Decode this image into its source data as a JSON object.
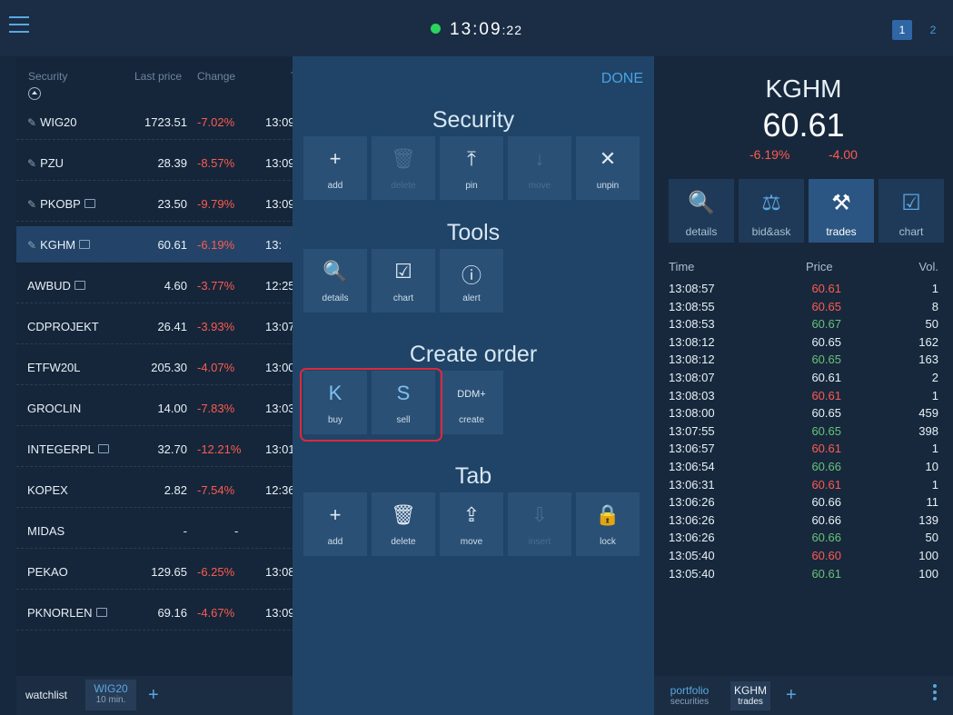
{
  "header": {
    "clock_main": "13:09",
    "clock_seconds": ":22",
    "pages": [
      "1",
      "2"
    ]
  },
  "watchlist": {
    "columns": {
      "security": "Security",
      "last_price": "Last price",
      "change": "Change",
      "time": "T"
    },
    "rows": [
      {
        "name": "WIG20",
        "price": "1723.51",
        "change": "-7.02%",
        "time": "13:09",
        "pin": true,
        "wallet": false
      },
      {
        "name": "PZU",
        "price": "28.39",
        "change": "-8.57%",
        "time": "13:09",
        "pin": true,
        "wallet": false
      },
      {
        "name": "PKOBP",
        "price": "23.50",
        "change": "-9.79%",
        "time": "13:09",
        "pin": true,
        "wallet": true
      },
      {
        "name": "KGHM",
        "price": "60.61",
        "change": "-6.19%",
        "time": "13:",
        "pin": true,
        "wallet": true
      },
      {
        "name": "AWBUD",
        "price": "4.60",
        "change": "-3.77%",
        "time": "12:25",
        "pin": false,
        "wallet": true
      },
      {
        "name": "CDPROJEKT",
        "price": "26.41",
        "change": "-3.93%",
        "time": "13:07",
        "pin": false,
        "wallet": false
      },
      {
        "name": "ETFW20L",
        "price": "205.30",
        "change": "-4.07%",
        "time": "13:00",
        "pin": false,
        "wallet": false
      },
      {
        "name": "GROCLIN",
        "price": "14.00",
        "change": "-7.83%",
        "time": "13:03",
        "pin": false,
        "wallet": false
      },
      {
        "name": "INTEGERPL",
        "price": "32.70",
        "change": "-12.21%",
        "time": "13:01",
        "pin": false,
        "wallet": true
      },
      {
        "name": "KOPEX",
        "price": "2.82",
        "change": "-7.54%",
        "time": "12:36",
        "pin": false,
        "wallet": false
      },
      {
        "name": "MIDAS",
        "price": "-",
        "change": "-",
        "time": "",
        "pin": false,
        "wallet": false
      },
      {
        "name": "PEKAO",
        "price": "129.65",
        "change": "-6.25%",
        "time": "13:08",
        "pin": false,
        "wallet": false
      },
      {
        "name": "PKNORLEN",
        "price": "69.16",
        "change": "-4.67%",
        "time": "13:09",
        "pin": false,
        "wallet": true
      }
    ],
    "tabs": {
      "watchlist": "watchlist",
      "wig20": "WIG20",
      "wig20_sub": "10 min.",
      "add": "+"
    }
  },
  "menu": {
    "done": "DONE",
    "security": {
      "title": "Security",
      "items": [
        {
          "glyph": "+",
          "label": "add",
          "icon": "plus-icon",
          "disabled": false
        },
        {
          "glyph": "🗑",
          "label": "delete",
          "icon": "trash-icon",
          "disabled": true
        },
        {
          "glyph": "⤒",
          "label": "pin",
          "icon": "pin-icon",
          "disabled": false
        },
        {
          "glyph": "↓",
          "label": "move",
          "icon": "arrow-down-icon",
          "disabled": true
        },
        {
          "glyph": "✕",
          "label": "unpin",
          "icon": "unpin-icon",
          "disabled": false
        }
      ]
    },
    "tools": {
      "title": "Tools",
      "items": [
        {
          "glyph": "🔍",
          "label": "details",
          "icon": "magnifier-icon",
          "disabled": false
        },
        {
          "glyph": "☑",
          "label": "chart",
          "icon": "chart-icon",
          "disabled": false
        },
        {
          "glyph": "ⓘ",
          "label": "alert",
          "icon": "alert-icon",
          "disabled": false
        }
      ]
    },
    "order": {
      "title": "Create order",
      "items": [
        {
          "glyph": "K",
          "label": "buy",
          "icon": "buy-icon",
          "disabled": false
        },
        {
          "glyph": "S",
          "label": "sell",
          "icon": "sell-icon",
          "disabled": false
        },
        {
          "glyph": "DDM+",
          "label": "create",
          "icon": "ddm-icon",
          "disabled": false
        }
      ]
    },
    "tab": {
      "title": "Tab",
      "items": [
        {
          "glyph": "+",
          "label": "add",
          "icon": "plus-icon",
          "disabled": false
        },
        {
          "glyph": "🗑",
          "label": "delete",
          "icon": "trash-icon",
          "disabled": false
        },
        {
          "glyph": "⇪",
          "label": "move",
          "icon": "upload-icon",
          "disabled": false
        },
        {
          "glyph": "⇩",
          "label": "insert",
          "icon": "download-icon",
          "disabled": true
        },
        {
          "glyph": "🔒",
          "label": "lock",
          "icon": "lock-icon",
          "disabled": false
        }
      ]
    }
  },
  "detail": {
    "ticker": "KGHM",
    "price": "60.61",
    "change_pct": "-6.19%",
    "change_abs": "-4.00",
    "buttons": [
      {
        "glyph": "🔍",
        "label": "details",
        "icon": "magnifier-icon"
      },
      {
        "glyph": "⚖",
        "label": "bid&ask",
        "icon": "scales-icon"
      },
      {
        "glyph": "⚒",
        "label": "trades",
        "icon": "gavel-icon"
      },
      {
        "glyph": "☑",
        "label": "chart",
        "icon": "chart-icon"
      }
    ],
    "table_headers": {
      "time": "Time",
      "price": "Price",
      "vol": "Vol."
    },
    "trades": [
      {
        "time": "13:08:57",
        "price": "60.61",
        "vol": "1",
        "dir": "dn"
      },
      {
        "time": "13:08:55",
        "price": "60.65",
        "vol": "8",
        "dir": "dn"
      },
      {
        "time": "13:08:53",
        "price": "60.67",
        "vol": "50",
        "dir": "up"
      },
      {
        "time": "13:08:12",
        "price": "60.65",
        "vol": "162",
        "dir": "nt"
      },
      {
        "time": "13:08:12",
        "price": "60.65",
        "vol": "163",
        "dir": "up"
      },
      {
        "time": "13:08:07",
        "price": "60.61",
        "vol": "2",
        "dir": "nt"
      },
      {
        "time": "13:08:03",
        "price": "60.61",
        "vol": "1",
        "dir": "dn"
      },
      {
        "time": "13:08:00",
        "price": "60.65",
        "vol": "459",
        "dir": "nt"
      },
      {
        "time": "13:07:55",
        "price": "60.65",
        "vol": "398",
        "dir": "up"
      },
      {
        "time": "13:06:57",
        "price": "60.61",
        "vol": "1",
        "dir": "dn"
      },
      {
        "time": "13:06:54",
        "price": "60.66",
        "vol": "10",
        "dir": "up"
      },
      {
        "time": "13:06:31",
        "price": "60.61",
        "vol": "1",
        "dir": "dn"
      },
      {
        "time": "13:06:26",
        "price": "60.66",
        "vol": "11",
        "dir": "nt"
      },
      {
        "time": "13:06:26",
        "price": "60.66",
        "vol": "139",
        "dir": "nt"
      },
      {
        "time": "13:06:26",
        "price": "60.66",
        "vol": "50",
        "dir": "up"
      },
      {
        "time": "13:05:40",
        "price": "60.60",
        "vol": "100",
        "dir": "dn"
      },
      {
        "time": "13:05:40",
        "price": "60.61",
        "vol": "100",
        "dir": "up"
      }
    ],
    "tabs": {
      "portfolio": "portfolio",
      "portfolio_sub": "securities",
      "kghm": "KGHM",
      "kghm_sub": "trades",
      "add": "+"
    }
  }
}
